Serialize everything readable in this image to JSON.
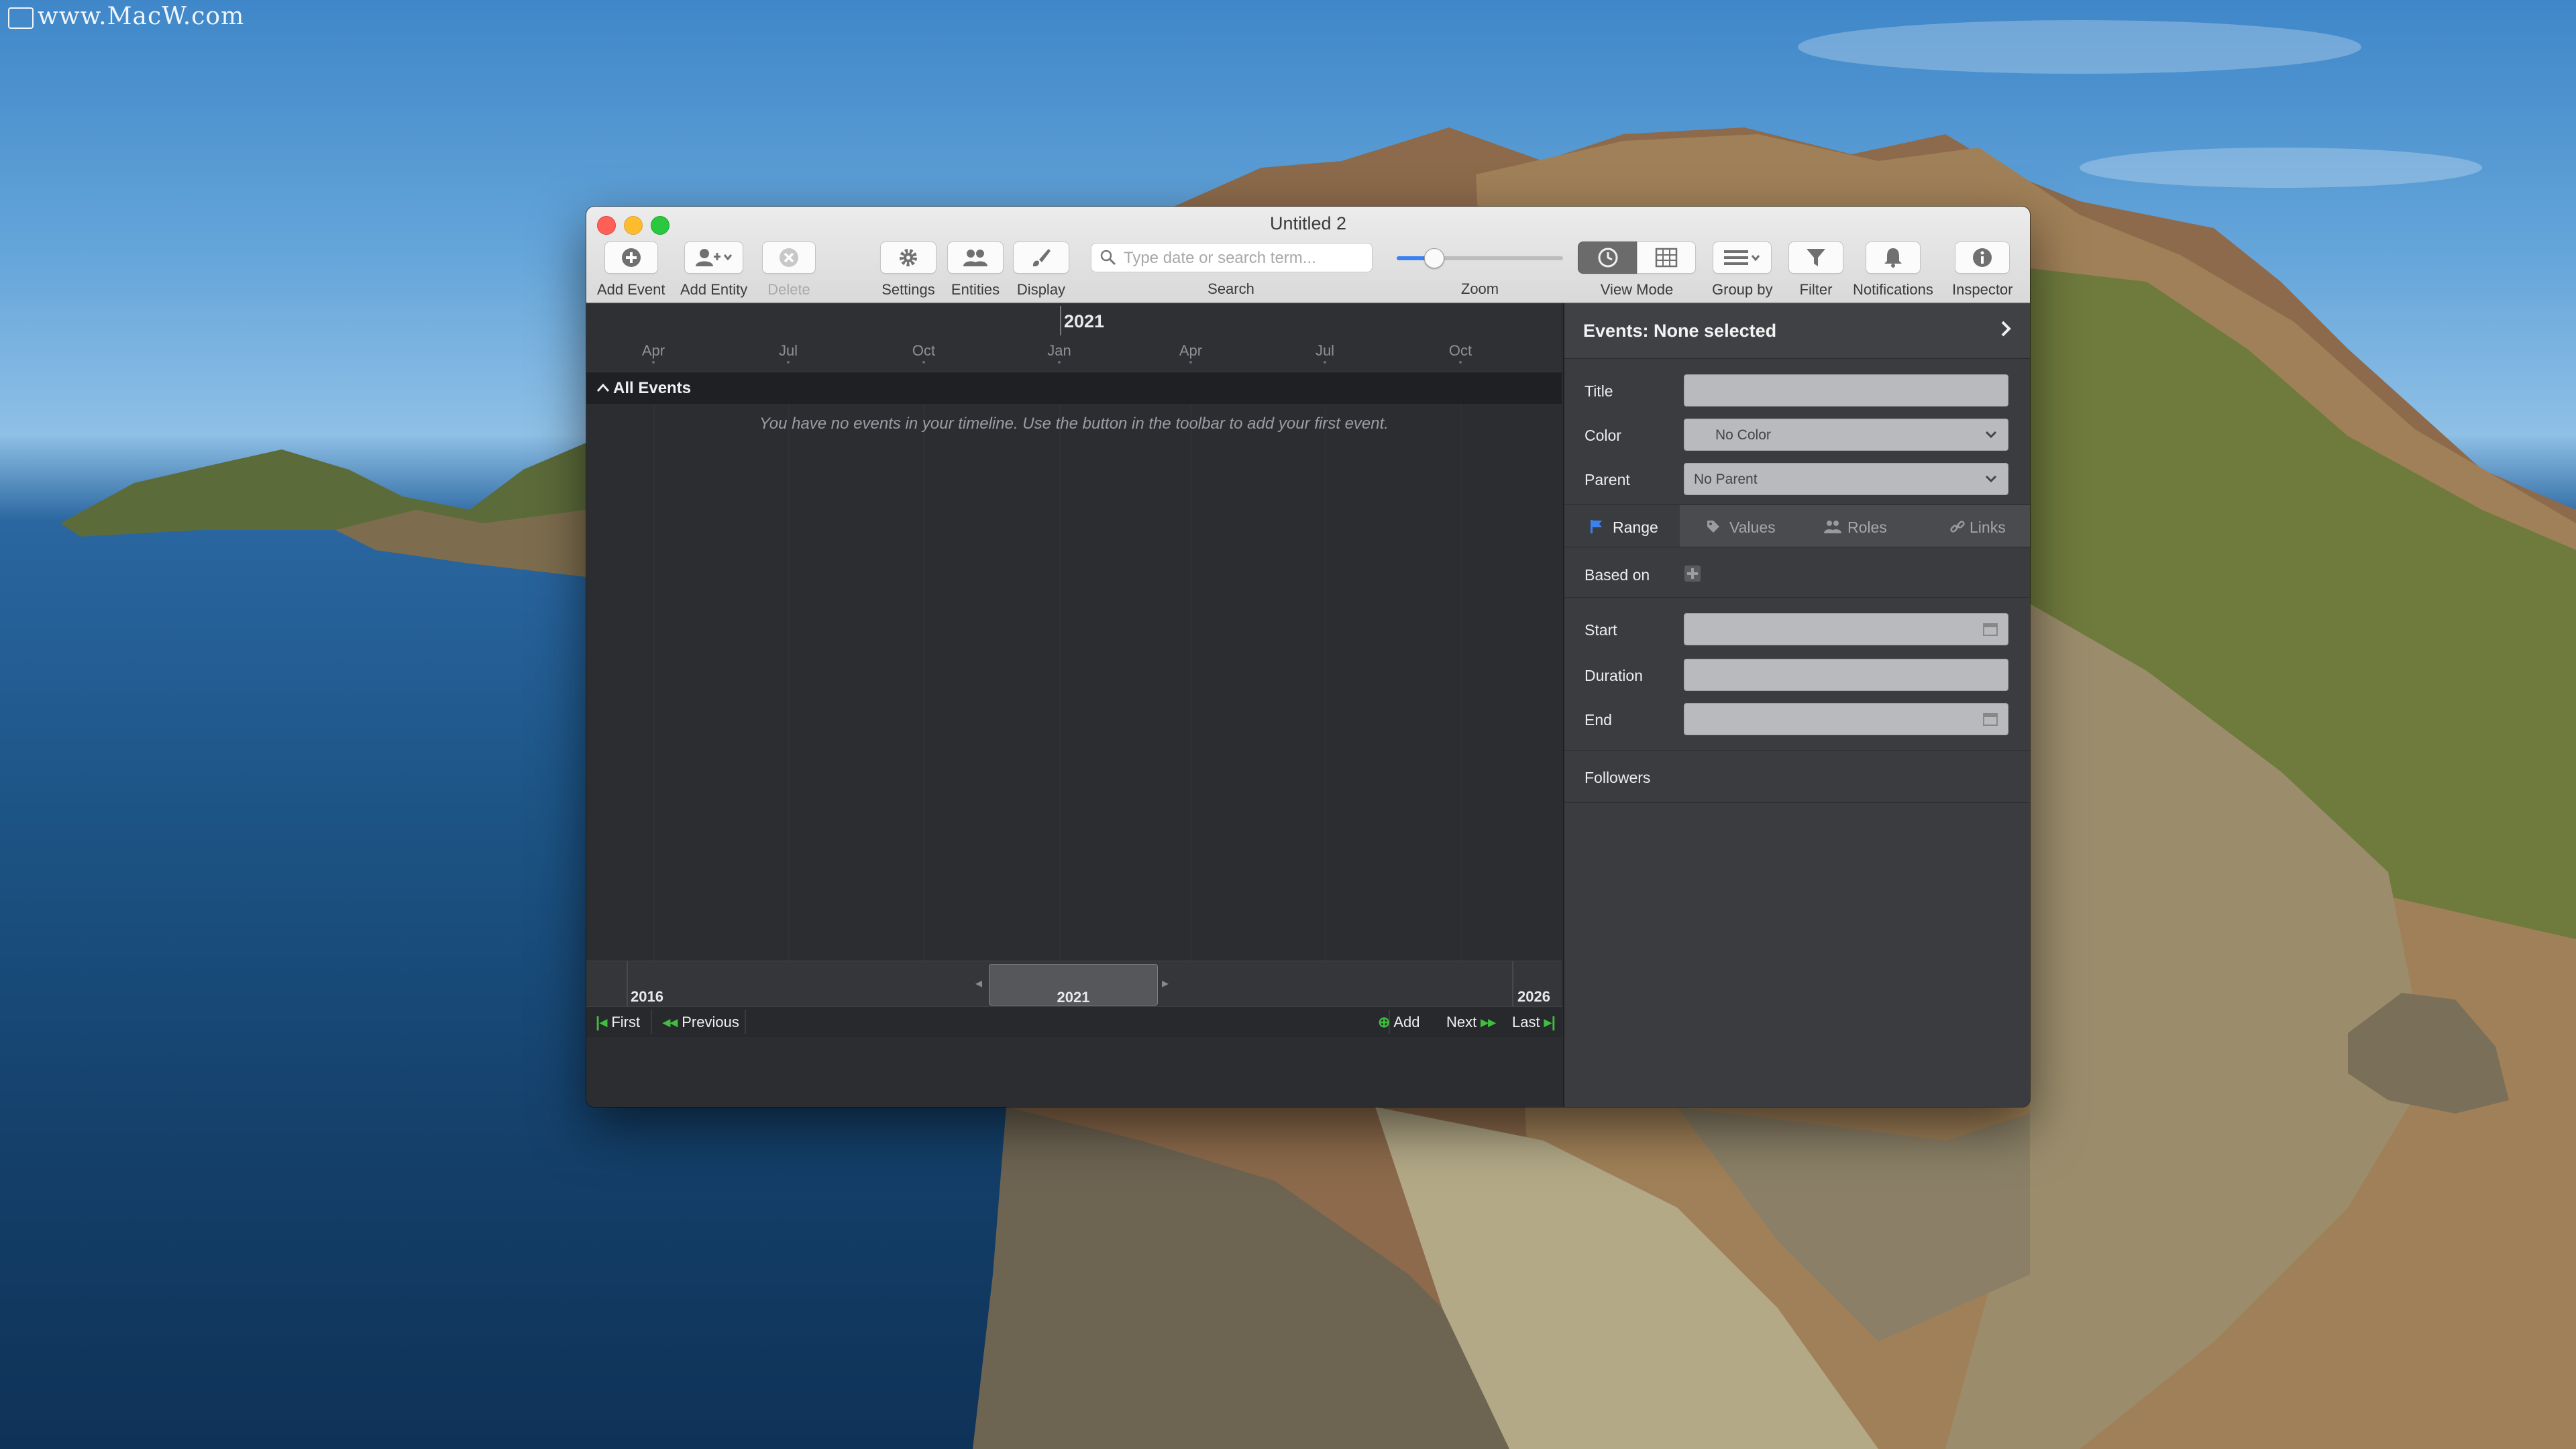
{
  "watermark": "www.MacW.com",
  "window": {
    "title": "Untitled 2"
  },
  "toolbar": {
    "add_event": "Add Event",
    "add_entity": "Add Entity",
    "delete": "Delete",
    "settings": "Settings",
    "entities": "Entities",
    "display": "Display",
    "search_placeholder": "Type date or search term...",
    "search_label": "Search",
    "zoom_label": "Zoom",
    "zoom_level": 0.22,
    "view_mode": "View Mode",
    "group_by": "Group by",
    "filter": "Filter",
    "notifications": "Notifications",
    "inspector": "Inspector"
  },
  "timeline": {
    "year": "2021",
    "months": [
      "Apr",
      "Jul",
      "Oct",
      "Jan",
      "Apr",
      "Jul",
      "Oct"
    ],
    "group": "All Events",
    "empty_message": "You have no events in your timeline. Use the button in the toolbar to add your first event.",
    "overview": {
      "start_year": "2016",
      "current_year": "2021",
      "end_year": "2026"
    },
    "nav": {
      "first": "First",
      "previous": "Previous",
      "add": "Add",
      "next": "Next",
      "last": "Last"
    }
  },
  "inspector": {
    "header": "Events: None selected",
    "fields": {
      "title_label": "Title",
      "color_label": "Color",
      "color_value": "No Color",
      "parent_label": "Parent",
      "parent_value": "No Parent"
    },
    "tabs": [
      "Range",
      "Values",
      "Roles",
      "Links"
    ],
    "based_on": "Based on",
    "start": "Start",
    "duration": "Duration",
    "end": "End",
    "followers": "Followers"
  },
  "colors": {
    "accent": "#3b82f0",
    "nav_green": "#3fbf3f",
    "close": "#fe5f57",
    "minimize": "#febb2e",
    "zoom": "#29c840"
  }
}
